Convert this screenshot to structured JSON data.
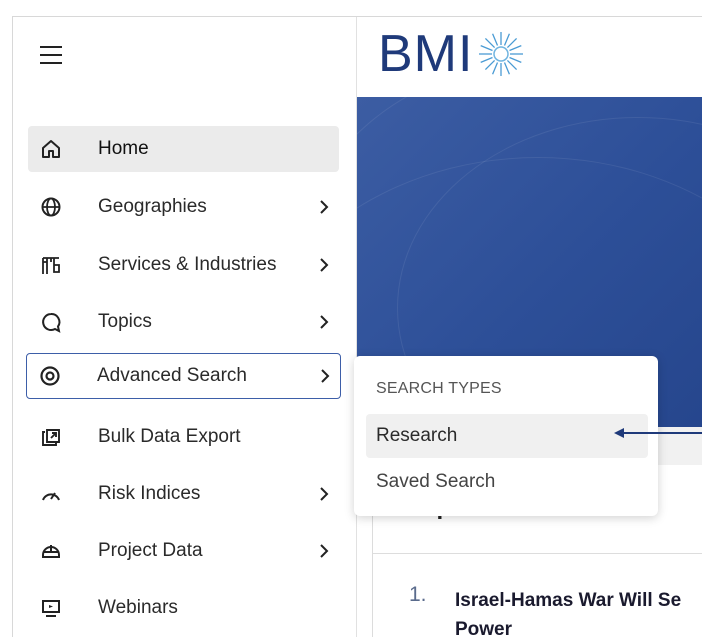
{
  "sidebar": {
    "items": [
      {
        "label": "Home",
        "icon": "home-icon"
      },
      {
        "label": "Geographies",
        "icon": "globe-icon"
      },
      {
        "label": "Services & Industries",
        "icon": "crane-icon"
      },
      {
        "label": "Topics",
        "icon": "chat-bubble-icon"
      },
      {
        "label": "Advanced Search",
        "icon": "target-icon"
      },
      {
        "label": "Bulk Data Export",
        "icon": "export-icon"
      },
      {
        "label": "Risk Indices",
        "icon": "gauge-icon"
      },
      {
        "label": "Project Data",
        "icon": "helmet-icon"
      },
      {
        "label": "Webinars",
        "icon": "monitor-icon"
      }
    ]
  },
  "logo": {
    "text": "BMI"
  },
  "dropdown": {
    "header": "SEARCH TYPES",
    "items": [
      {
        "label": "Research"
      },
      {
        "label": "Saved Search"
      }
    ]
  },
  "top_reads": {
    "title": "Top Reads",
    "items": [
      {
        "number": "1.",
        "title_line1": "Israel-Hamas War Will Se",
        "title_line2": "Power"
      }
    ]
  },
  "colors": {
    "brand": "#1f3a7a",
    "hero": "#2d4f98",
    "active_border": "#3d5ea8"
  }
}
